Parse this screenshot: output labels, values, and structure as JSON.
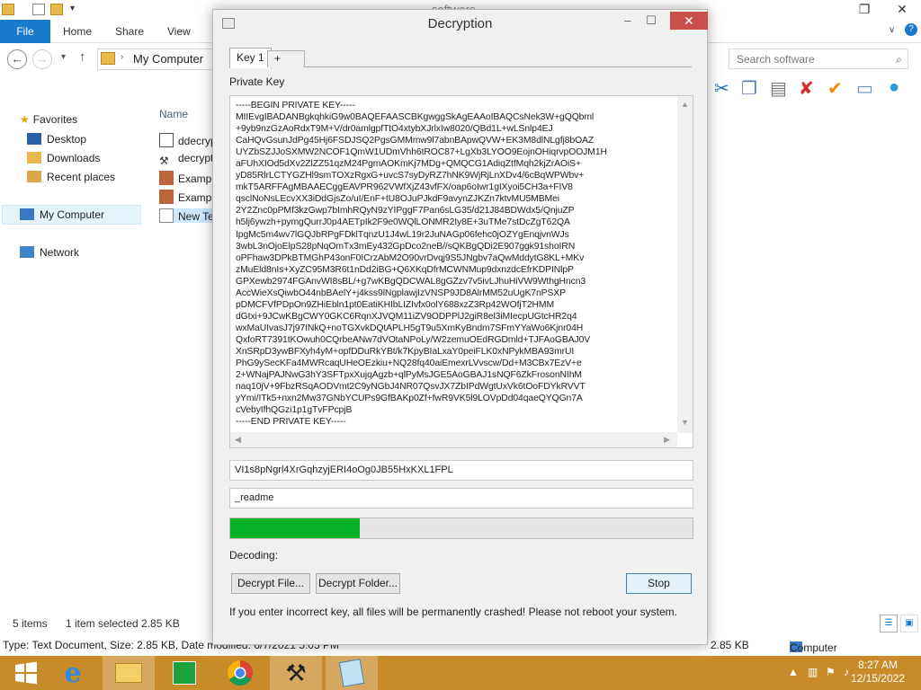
{
  "explorer": {
    "title": "software",
    "ribbon_tabs": [
      "File",
      "Home",
      "Share",
      "View"
    ],
    "address": "My Computer",
    "search_placeholder": "Search software",
    "nav": {
      "favorites": "Favorites",
      "desktop": "Desktop",
      "downloads": "Downloads",
      "recent_places": "Recent places",
      "my_computer": "My Computer",
      "network": "Network"
    },
    "column_header": "Name",
    "files": [
      "ddecryp",
      "decrypt",
      "Exampl",
      "Exampl",
      "New Te"
    ],
    "status": {
      "items": "5 items",
      "selected": "1 item selected  2.85 KB"
    },
    "details": {
      "type_text": "Type: Text Document, Size: 2.85 KB, Date modified: 6/7/2021 5:03 PM",
      "size": "2.85 KB",
      "location": "Computer"
    }
  },
  "dialog": {
    "title": "Decryption",
    "tabs": [
      "Key 1",
      "+"
    ],
    "private_key_label": "Private Key",
    "private_key_text": "-----BEGIN PRIVATE KEY-----\nMIIEvgIBADANBgkqhkiG9w0BAQEFAASCBKgwggSkAgEAAoIBAQCsNek3W+gQQbml\n+9yb9nzGzAoRdxT9M+V/dr0amlgpfTtO4xtybXJrlxIw8020/QBd1L+wLSnlp4EJ\nCaHQvGsunJdPg45Hj6FSDJSQ2PgsGMMmw9l7abnBApwQVW+EK3M8dlNLgfj8bOAZ\nUYZbSZJJoSXMW2NCOF1QmW1UDmVhh6tROC87+LgXb3LYOO9EojnOHiqrvpOOJM1H\naFUhXIOd5dXv2ZlZZ51qzM24PgmAOKmKj7MDg+QMQCG1AdiqZtfMqh2kjZrAOiS+\nyD85RlrLCTYGZHl9smTOXzRgxG+uvcS7syDyRZ7hNK9WjRjLnXDv4/6cBqWPWbv+\nmkT5ARFFAgMBAAECggEAVPR962VWfXjZ43vfFX/oap6oIwr1gIXyoi5CH3a+FIV8\nqsclNoNsLEcvXX3iDdGjsZo/uI/EnF+tU8OJuPJkdF9avynZJKZn7ktvMU5MBMei\n2Y2Znc0pPMf3kzGwp7bImhRQyN9zYIPggF7Pan6sLG35/d21J84BDWdx5/QnjuZP\nh5lj6ywzh+pymgQurrJ0p4AETpIk2F9e0WQlLONMR2Iy8E+3uTMe7stDcZgT62QA\nIpgMc5m4wv7lGQJbRPgFDklTqnzU1J4wL19r2JuNAGp06fehc0jOZYgEnqjvnWJs\n3wbL3nOjoElpS28pNqOmTx3mEy432GpDco2neB//sQKBgQDi2E907ggk91shoIRN\noPFhaw3DPkBTMGhP43onF0ICrzAbM2O90vrDvqj9S5JNgbv7aQwMddytG8KL+MKv\nzMuEld8nIs+XyZC95M3R6t1nDd2iBG+Q6XKqDfrMCWNMup9dxnzdcEfrKDPINlpP\nGPXewb2974FGAnvWI8sBL/+g7wKBgQDCWAL8gGZzv7v5ivLJhuHiVW9WthgHncn3\nAccWieXsQiwbO44nbBAelY+j4kss9lNgplawjIzVNSP9JD8AlrMM52uUgK7nPSXP\npDMCFVfPDpOn9ZHiEbln1pt0EatiKHIbLIZIvfx0olY688xzZ3Rp42WOfjT2HMM\ndGtxi+9JCwKBgCWY0GKC6RqnXJVQM11iZV9ODPPlJ2giR8el3iMIecpUGtcHR2q4\nwxMaUIvasJ7j97INkQ+noTGXvkDQtAPLH5gT9u5XmKyBndm7SFmYYaWo6Kjnr04H\nQxfoRT7391tKOwuh0CQrbeANw7dVOtaNPoLy/W2zemuOEdRGDmld+TJFAoGBAJ0V\nXnSRpD3ywBFXyh4yM+opfDDuRkYBt/k7KpyBIaLxaY0peiFLK0xNPykMBA93mrUI\nPhG9ySecKFa4MWRcaqUHeOEzkiu+NQ28fq40aiEmexrLVvscw/Dd+M3CBx7EzV+e\n2+WNajPAJNwG3hY3SFTpxXujqAgzb+qlPyMsJGE5AoGBAJ1sNQF6ZkFrosonNIhM\nnaq10jV+9FbzRSqAODVmt2C9yNGbJ4NR07QsvJX7ZbIPdWgtUxVk6tOoFDYkRVVT\nyYmi/ITk5+nxn2Mw37GNbYCUPs9GfBAKp0Zf+fwR9VK5l9LOVpDd04qaeQYQGn7A\ncVebyIfhQGzi1p1gTvFPcpjB\n-----END PRIVATE KEY-----",
    "key_field": "VI1s8pNgrl4XrGqhzyjERI4oOg0JB55HxKXL1FPL",
    "ext_field": "_readme",
    "progress": 0.28,
    "decoding_label": "Decoding:",
    "buttons": {
      "decrypt_file": "Decrypt File...",
      "decrypt_folder": "Decrypt Folder...",
      "stop": "Stop"
    },
    "warning": "If you enter incorrect key, all files will be permanently crashed! Please not reboot your system."
  },
  "taskbar": {
    "time": "8:27 AM",
    "date": "12/15/2022"
  },
  "colors": {
    "taskbar": "#c88b2a",
    "progress_fill": "#06b025",
    "file_tab": "#1979ca",
    "close_button": "#c7504a"
  }
}
